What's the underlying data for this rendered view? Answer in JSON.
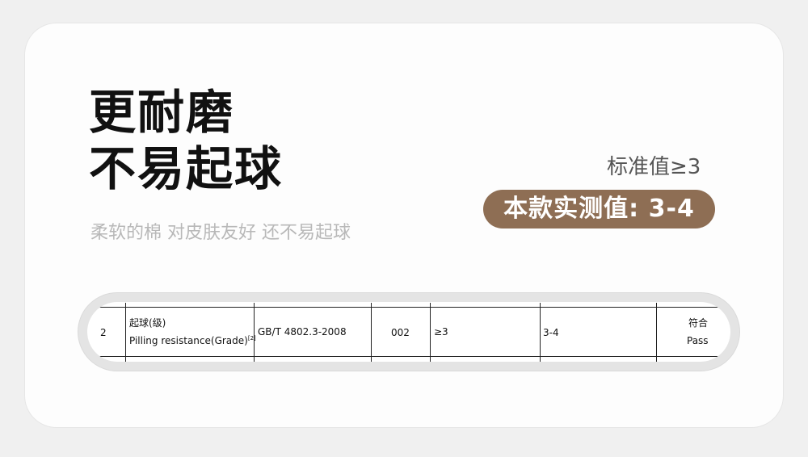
{
  "headline": {
    "line1": "更耐磨",
    "line2": "不易起球"
  },
  "subtitle": "柔软的棉 对皮肤友好 还不易起球",
  "standard_label": "标准值≥3",
  "measured_badge": "本款实测值: 3-4",
  "test_row": {
    "no": "2",
    "item_cn": "起球(级)",
    "item_en": "Pilling resistance(Grade)",
    "item_note": "[2]",
    "method": "GB/T 4802.3-2008",
    "code": "002",
    "requirement": "≥3",
    "result": "3-4",
    "verdict_cn": "符合",
    "verdict_en": "Pass"
  },
  "colors": {
    "badge": "#8e6e54",
    "card": "#fdfdfd",
    "subtitle": "#b8b8b8"
  }
}
